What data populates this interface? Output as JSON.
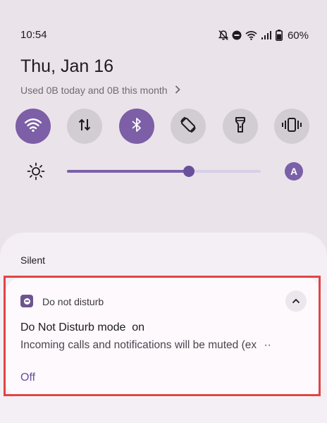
{
  "status_bar": {
    "time": "10:54",
    "icons": [
      "notifications-off-icon",
      "do-not-disturb-icon",
      "wifi-icon",
      "cell-signal-icon",
      "battery-icon"
    ],
    "battery": "60%"
  },
  "header": {
    "date": "Thu, Jan 16",
    "data_usage": "Used 0B today and 0B this month"
  },
  "quick_tiles": [
    {
      "name": "wifi",
      "icon": "wifi-icon",
      "active": true
    },
    {
      "name": "mobile-data",
      "icon": "data-transfer-icon",
      "active": false
    },
    {
      "name": "bluetooth",
      "icon": "bluetooth-icon",
      "active": true
    },
    {
      "name": "auto-rotate",
      "icon": "rotate-icon",
      "active": false
    },
    {
      "name": "flashlight",
      "icon": "flashlight-icon",
      "active": false
    },
    {
      "name": "vibrate",
      "icon": "vibrate-icon",
      "active": false
    }
  ],
  "brightness": {
    "level": 0.63,
    "auto_label": "A"
  },
  "notifications": {
    "section_label": "Silent",
    "card": {
      "app_name": "Do not disturb",
      "title": "Do Not Disturb mode  on",
      "body": "Incoming calls and notifications will be muted (ex",
      "truncation": "··",
      "action": "Off"
    }
  },
  "colors": {
    "accent": "#7c5fa6",
    "tile_inactive": "#d2cdd3",
    "highlight": "#e04545"
  }
}
